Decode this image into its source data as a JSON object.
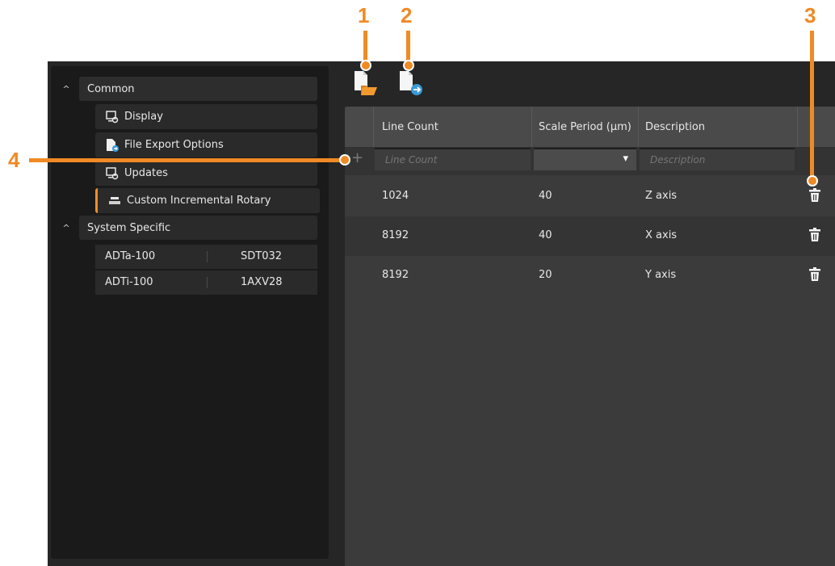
{
  "sidebar": {
    "groups": [
      {
        "label": "Common"
      },
      {
        "label": "System Specific"
      }
    ],
    "common_items": [
      {
        "label": "Display",
        "icon": "display-settings-icon"
      },
      {
        "label": "File Export Options",
        "icon": "file-export-icon"
      },
      {
        "label": "Updates",
        "icon": "updates-settings-icon"
      },
      {
        "label": "Custom Incremental Rotary",
        "icon": "rotary-encoder-icon",
        "active": true
      }
    ],
    "systems": [
      {
        "model": "ADTa-100",
        "serial": "SDT032"
      },
      {
        "model": "ADTi-100",
        "serial": "1AXV28"
      }
    ]
  },
  "toolbar": {
    "buttons": [
      {
        "name": "open-file-button",
        "icon": "open-file-icon"
      },
      {
        "name": "export-file-button",
        "icon": "export-file-icon"
      }
    ]
  },
  "table": {
    "headers": [
      "Line Count",
      "Scale Period (µm)",
      "Description"
    ],
    "new_row": {
      "add_icon": "+",
      "line_count_placeholder": "Line Count",
      "description_placeholder": "Description",
      "dropdown_arrow": "▾"
    },
    "rows": [
      {
        "line_count": "1024",
        "scale_period": "40",
        "description": "Z axis"
      },
      {
        "line_count": "8192",
        "scale_period": "40",
        "description": "X axis"
      },
      {
        "line_count": "8192",
        "scale_period": "20",
        "description": "Y axis"
      }
    ]
  },
  "callouts": [
    "1",
    "2",
    "3",
    "4"
  ],
  "colors": {
    "accent": "#f08a24",
    "background": "#262626",
    "panel": "#3b3b3b"
  }
}
